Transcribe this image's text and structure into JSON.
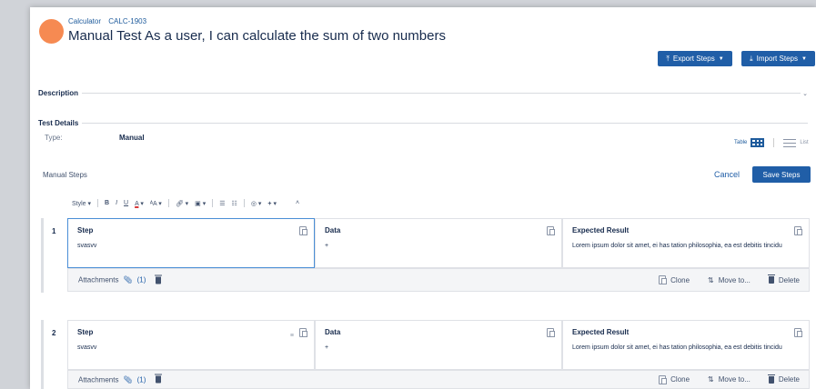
{
  "breadcrumb": {
    "project": "Calculator",
    "key": "CALC-1903"
  },
  "page_title": "Manual Test As a user, I can calculate the sum of two numbers",
  "buttons": {
    "export_steps": "Export Steps",
    "import_steps": "Import Steps",
    "cancel": "Cancel",
    "save_steps": "Save Steps"
  },
  "sections": {
    "description": "Description",
    "test_details": "Test Details"
  },
  "details": {
    "type_label": "Type:",
    "type_value": "Manual"
  },
  "view_toggle": {
    "table": "Table",
    "list": "List"
  },
  "manual_steps_label": "Manual Steps",
  "toolbar": {
    "style": "Style",
    "bold": "B",
    "italic": "I",
    "underline": "U",
    "color": "A",
    "size": "ᴬA",
    "link": "🔗",
    "insert": "▣",
    "ul": "☰",
    "ol": "☷",
    "emoji": "◎",
    "add": "+",
    "collapse": "˄"
  },
  "columns": {
    "step": "Step",
    "data": "Data",
    "expected": "Expected Result"
  },
  "steps": [
    {
      "number": "1",
      "step": "svasvv",
      "data": "+",
      "expected": "Lorem ipsum dolor sit amet, ei has tation philosophia, ea est debitis tincidu",
      "attachments_label": "Attachments",
      "attachments_count": "(1)",
      "clone": "Clone",
      "move": "Move to...",
      "delete": "Delete"
    },
    {
      "number": "2",
      "step": "svasvv",
      "data": "+",
      "expected": "Lorem ipsum dolor sit amet, ei has tation philosophia, ea est debitis tincidu",
      "attachments_label": "Attachments",
      "attachments_count": "(1)",
      "clone": "Clone",
      "move": "Move to...",
      "delete": "Delete"
    }
  ],
  "colors": {
    "primary": "#205ea7",
    "avatar": "#f68a52",
    "active_border": "#4a8ed6"
  }
}
